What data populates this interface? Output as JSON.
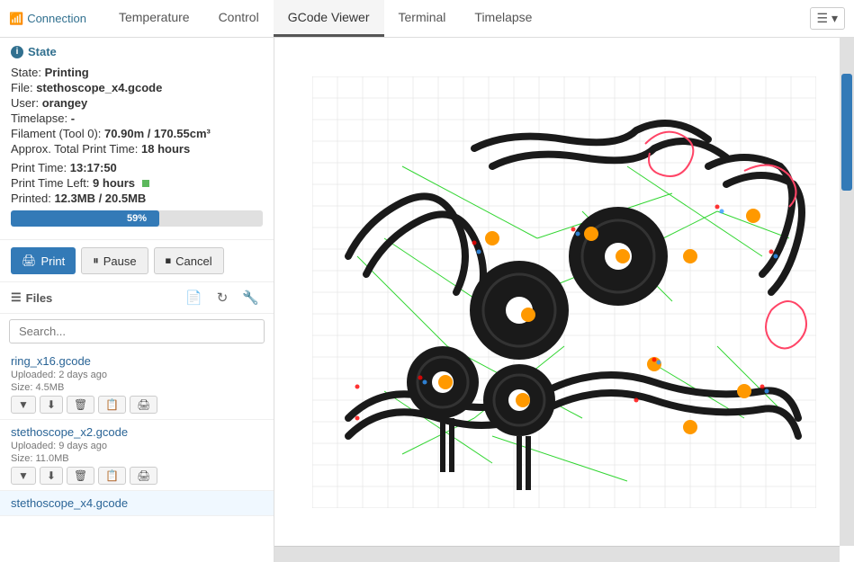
{
  "connection": {
    "label": "Connection",
    "icon": "signal-icon"
  },
  "tabs": [
    {
      "id": "temperature",
      "label": "Temperature",
      "active": false
    },
    {
      "id": "control",
      "label": "Control",
      "active": false
    },
    {
      "id": "gcode-viewer",
      "label": "GCode Viewer",
      "active": true
    },
    {
      "id": "terminal",
      "label": "Terminal",
      "active": false
    },
    {
      "id": "timelapse",
      "label": "Timelapse",
      "active": false
    }
  ],
  "state": {
    "section_label": "State",
    "state_label": "State:",
    "state_value": "Printing",
    "file_label": "File:",
    "file_value": "stethoscope_x4.gcode",
    "user_label": "User:",
    "user_value": "orangey",
    "timelapse_label": "Timelapse:",
    "timelapse_value": "-",
    "filament_label": "Filament (Tool 0):",
    "filament_value": "70.90m / 170.55cm³",
    "approx_label": "Approx. Total Print Time:",
    "approx_value": "18 hours",
    "print_time_label": "Print Time:",
    "print_time_value": "13:17:50",
    "print_time_left_label": "Print Time Left:",
    "print_time_left_value": "9 hours",
    "printed_label": "Printed:",
    "printed_value": "12.3MB / 20.5MB",
    "progress_pct": 59,
    "progress_label": "59%"
  },
  "buttons": {
    "print_label": "Print",
    "pause_label": "Pause",
    "cancel_label": "Cancel"
  },
  "files": {
    "section_label": "Files",
    "search_placeholder": "Search...",
    "items": [
      {
        "name": "ring_x16.gcode",
        "uploaded": "Uploaded: 2 days ago",
        "size": "Size: 4.5MB"
      },
      {
        "name": "stethoscope_x2.gcode",
        "uploaded": "Uploaded: 9 days ago",
        "size": "Size: 11.0MB"
      },
      {
        "name": "stethoscope_x4.gcode",
        "uploaded": "",
        "size": ""
      }
    ],
    "file_actions": [
      "▼",
      "⬇",
      "🗑",
      "📋",
      "🖨"
    ]
  }
}
